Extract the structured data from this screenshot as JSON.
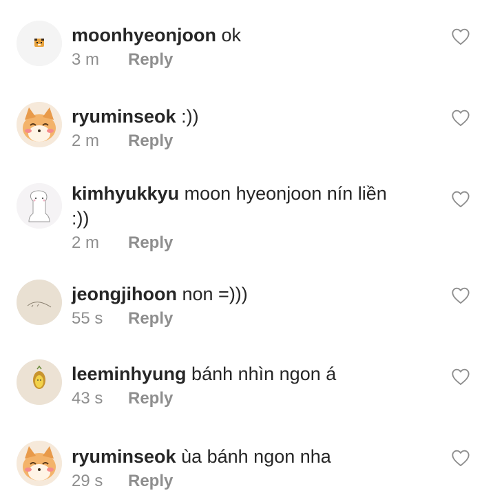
{
  "comments": [
    {
      "username": "moonhyeonjoon",
      "text": "ok",
      "time": "3 m",
      "reply_label": "Reply",
      "avatar_icon": "tiger-avatar-icon"
    },
    {
      "username": "ryuminseok",
      "text": ":))",
      "time": "2 m",
      "reply_label": "Reply",
      "avatar_icon": "shiba-avatar-icon"
    },
    {
      "username": "kimhyukkyu",
      "text": "moon hyeonjoon nín liền :))",
      "time": "2 m",
      "reply_label": "Reply",
      "avatar_icon": "alpaca-avatar-icon"
    },
    {
      "username": "jeongjihoon",
      "text": "non =)))",
      "time": "55 s",
      "reply_label": "Reply",
      "avatar_icon": "sketch-avatar-icon"
    },
    {
      "username": "leeminhyung",
      "text": "bánh nhìn ngon á",
      "time": "43 s",
      "reply_label": "Reply",
      "avatar_icon": "sweet-potato-avatar-icon"
    },
    {
      "username": "ryuminseok",
      "text": "ùa bánh ngon nha",
      "time": "29 s",
      "reply_label": "Reply",
      "avatar_icon": "shiba-avatar-icon"
    }
  ],
  "like_icon": "heart-outline-icon",
  "colors": {
    "username": "#262626",
    "text": "#262626",
    "meta": "#8e8e8e",
    "icon": "#8e8e8e",
    "background": "#ffffff"
  }
}
